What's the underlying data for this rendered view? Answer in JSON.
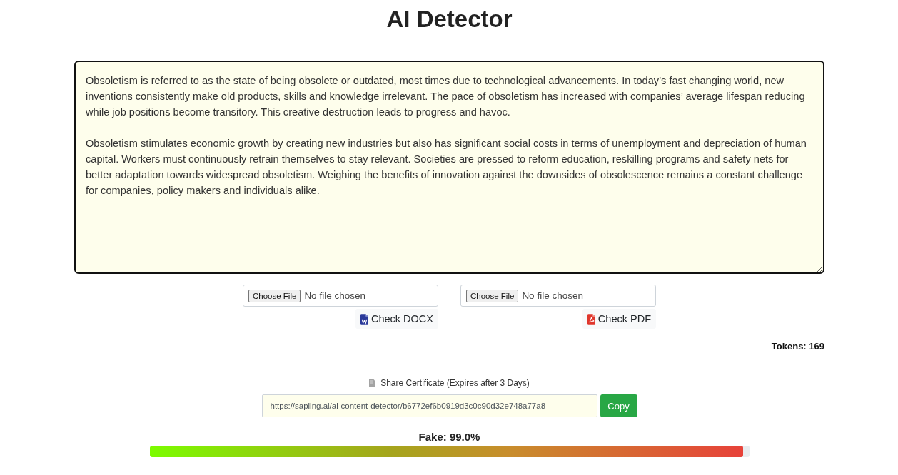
{
  "title": "AI Detector",
  "text_input": {
    "value": "Obsoletism is referred to as the state of being obsolete or outdated, most times due to technological advancements. In today’s fast changing world, new inventions consistently make old products, skills and knowledge irrelevant. The pace of obsoletism has increased with companies’ average lifespan reducing while job positions become transitory. This creative destruction leads to progress and havoc.\n\nObsoletism stimulates economic growth by creating new industries but also has significant social costs in terms of unemployment and depreciation of human capital. Workers must continuously retrain themselves to stay relevant. Societies are pressed to reform education, reskilling programs and safety nets for better adaptation towards widespread obsoletism. Weighing the benefits of innovation against the downsides of obsolescence remains a constant challenge for companies, policy makers and individuals alike."
  },
  "uploads": [
    {
      "kind": "docx",
      "button": "Choose File",
      "status": "No file chosen",
      "action": "Check DOCX"
    },
    {
      "kind": "pdf",
      "button": "Choose File",
      "status": "No file chosen",
      "action": "Check PDF"
    }
  ],
  "tokens": "Tokens: 169",
  "share": {
    "label": "Share Certificate (Expires after 3 Days)",
    "url": "https://sapling.ai/ai-content-detector/b6772ef6b0919d3c0c90d32e748a77a8",
    "button": "Copy"
  },
  "result": {
    "label": "Fake: 99.0%",
    "level": 0.99
  }
}
